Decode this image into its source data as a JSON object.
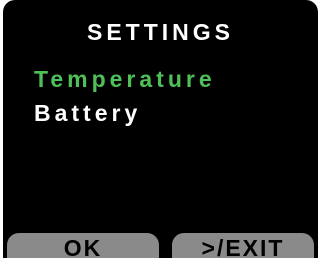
{
  "screen": {
    "title": "SETTINGS",
    "menu": {
      "items": [
        {
          "label": "Temperature",
          "selected": true
        },
        {
          "label": "Battery",
          "selected": false
        }
      ],
      "selected_color": "#4fbf58",
      "item_color": "#ffffff"
    },
    "softkeys": {
      "ok_label": "OK",
      "exit_label": ">/EXIT"
    },
    "colors": {
      "background": "#000000",
      "softkey": "#8a8a8a"
    }
  }
}
